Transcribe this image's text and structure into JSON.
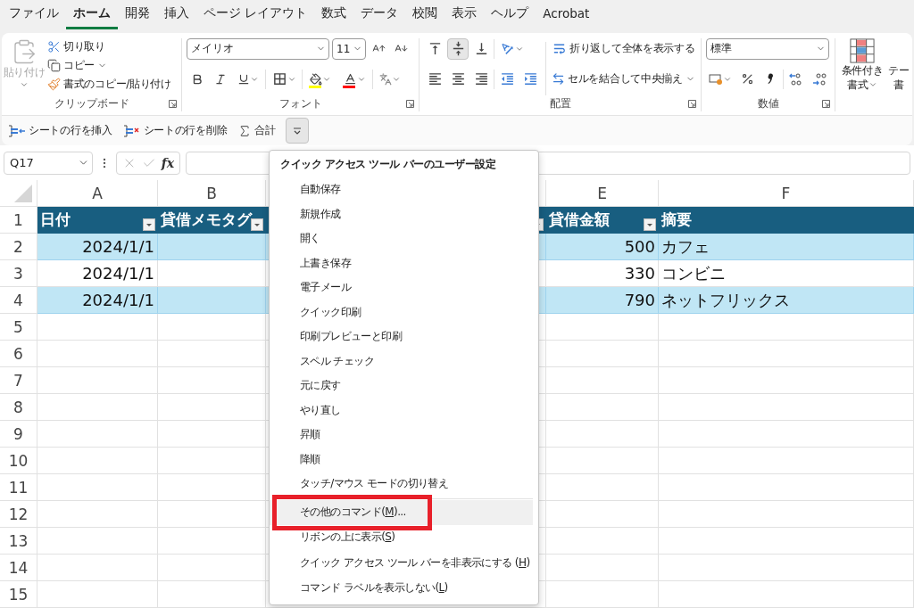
{
  "tabs": [
    {
      "label": "ファイル",
      "selected": false
    },
    {
      "label": "ホーム",
      "selected": true
    },
    {
      "label": "開発",
      "selected": false
    },
    {
      "label": "挿入",
      "selected": false
    },
    {
      "label": "ページ レイアウト",
      "selected": false
    },
    {
      "label": "数式",
      "selected": false
    },
    {
      "label": "データ",
      "selected": false
    },
    {
      "label": "校閲",
      "selected": false
    },
    {
      "label": "表示",
      "selected": false
    },
    {
      "label": "ヘルプ",
      "selected": false
    },
    {
      "label": "Acrobat",
      "selected": false
    }
  ],
  "clipboard": {
    "paste": {
      "label": "貼り付け",
      "disabled": true
    },
    "items": [
      {
        "kind": "cut",
        "label": "切り取り",
        "dropdown": false
      },
      {
        "kind": "copy",
        "label": "コピー",
        "dropdown": true
      },
      {
        "kind": "painter",
        "label": "書式のコピー/貼り付け",
        "dropdown": false
      }
    ],
    "group_label": "クリップボード"
  },
  "font": {
    "name": "メイリオ",
    "size": "11",
    "group_label": "フォント"
  },
  "alignment": {
    "valign": [
      {
        "kind": "top",
        "selected": false
      },
      {
        "kind": "middle",
        "selected": true
      },
      {
        "kind": "bottom",
        "selected": false
      }
    ],
    "wrap_label": "折り返して全体を表示する",
    "merge_label": "セルを結合して中央揃え",
    "group_label": "配置"
  },
  "number": {
    "format": "標準",
    "group_label": "数値"
  },
  "styles": [
    {
      "lines": [
        "条件付き",
        "書式"
      ],
      "dropdown": true
    },
    {
      "lines": [
        "テー",
        "書"
      ],
      "dropdown": false
    }
  ],
  "quick_access": {
    "buttons": [
      {
        "kind": "insert_row",
        "label": "シートの行を挿入"
      },
      {
        "kind": "delete_row",
        "label": "シートの行を削除"
      },
      {
        "kind": "sum",
        "label": "合計"
      }
    ],
    "customize_pressed": true
  },
  "formula_bar": {
    "name_box": "Q17",
    "function_label": "fx"
  },
  "sheet": {
    "columns": [
      {
        "letter": "A",
        "header": "日付",
        "filter": true
      },
      {
        "letter": "B",
        "header": "貸借メモタグ",
        "filter": true
      },
      {
        "filter": true
      },
      {
        "letter": "E",
        "header": "貸借金額",
        "filter": true
      },
      {
        "letter": "F",
        "header": "摘要",
        "filter": false
      }
    ],
    "row_numbers": [
      "1",
      "2",
      "3",
      "4",
      "5",
      "6",
      "7",
      "8",
      "9",
      "10",
      "11",
      "12",
      "13",
      "14",
      "15"
    ],
    "rows": [
      {
        "date": "2024/1/1",
        "amount": "500",
        "memo": "カフェ",
        "banded": true
      },
      {
        "date": "2024/1/1",
        "amount": "330",
        "memo": "コンビニ",
        "banded": false
      },
      {
        "date": "2024/1/1",
        "amount": "790",
        "memo": "ネットフリックス",
        "banded": true
      }
    ]
  },
  "menu": {
    "title": "クイック アクセス ツール バーのユーザー設定",
    "sections": [
      [
        {
          "label": "自動保存",
          "hovered": false,
          "annotated": false
        },
        {
          "label": "新規作成",
          "hovered": false,
          "annotated": false
        },
        {
          "label": "開く",
          "hovered": false,
          "annotated": false
        },
        {
          "label": "上書き保存",
          "hovered": false,
          "annotated": false
        },
        {
          "label": "電子メール",
          "hovered": false,
          "annotated": false
        },
        {
          "label": "クイック印刷",
          "hovered": false,
          "annotated": false
        },
        {
          "label": "印刷プレビューと印刷",
          "hovered": false,
          "annotated": false
        },
        {
          "label": "スペル チェック",
          "hovered": false,
          "annotated": false
        },
        {
          "label": "元に戻す",
          "hovered": false,
          "annotated": false
        },
        {
          "label": "やり直し",
          "hovered": false,
          "annotated": false
        },
        {
          "label": "昇順",
          "hovered": false,
          "annotated": false
        },
        {
          "label": "降順",
          "hovered": false,
          "annotated": false
        },
        {
          "label": "タッチ/マウス モードの切り替え",
          "hovered": false,
          "annotated": false
        }
      ],
      [
        {
          "before": "その他のコマンド(",
          "key": "M",
          "after": ")...",
          "hovered": true,
          "annotated": true
        },
        {
          "before": "リボンの上に表示(",
          "key": "S",
          "after": ")",
          "hovered": false,
          "annotated": false
        },
        {
          "before": "クイック アクセス ツール バーを非表示にする (",
          "key": "H",
          "after": ")",
          "hovered": false,
          "annotated": false
        },
        {
          "before": "コマンド ラベルを表示しない(",
          "key": "L",
          "after": ")",
          "hovered": false,
          "annotated": false
        }
      ]
    ]
  }
}
